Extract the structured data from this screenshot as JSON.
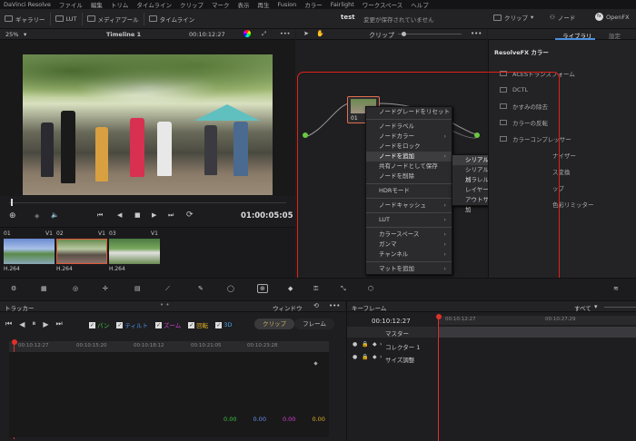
{
  "menubar": [
    "DaVinci Resolve",
    "ファイル",
    "編集",
    "トリム",
    "タイムライン",
    "クリップ",
    "マーク",
    "表示",
    "再生",
    "Fusion",
    "カラー",
    "Fairlight",
    "ワークスペース",
    "ヘルプ"
  ],
  "toolbar": {
    "gallery": "ギャラリー",
    "lut": "LUT",
    "media_pool": "メディアプール",
    "timeline": "タイムライン",
    "project": "test",
    "save_status": "変更が保存されていません",
    "clip": "クリップ",
    "node": "ノード",
    "openfx": "OpenFX"
  },
  "viewer": {
    "zoom": "25%",
    "timeline_name": "Timeline 1",
    "timecode_top": "00:10:12:27",
    "timecode": "01:00:05:05"
  },
  "nodebar": {
    "mode": "クリップ"
  },
  "library": {
    "tab_library": "ライブラリ",
    "tab_settings": "設定",
    "section": "ResolveFX カラー",
    "items": [
      "ACESトランスフォーム",
      "DCTL",
      "かすみの除去",
      "カラーの反転",
      "カラーコンプレッサー"
    ],
    "partial": [
      "ナイザー",
      "ス変換",
      "ップ",
      "色彩リミッター"
    ]
  },
  "clips": [
    {
      "num": "01",
      "track": "V1",
      "codec": "H.264"
    },
    {
      "num": "02",
      "track": "V1",
      "codec": "H.264"
    },
    {
      "num": "03",
      "track": "V1",
      "codec": "H.264"
    }
  ],
  "node": {
    "label": "01"
  },
  "ctx_menu": {
    "items": [
      {
        "label": "ノードグレードをリセット",
        "sub": false
      },
      {
        "sep": true
      },
      {
        "label": "ノードラベル",
        "sub": false
      },
      {
        "label": "ノードカラー",
        "sub": true
      },
      {
        "label": "ノードをロック",
        "sub": false
      },
      {
        "label": "ノードを追加",
        "sub": true,
        "hi": true
      },
      {
        "label": "共有ノードとして保存",
        "sub": false
      },
      {
        "label": "ノードを削除",
        "sub": false
      },
      {
        "sep": true
      },
      {
        "label": "HDRモード",
        "sub": false
      },
      {
        "sep": true
      },
      {
        "label": "ノードキャッシュ",
        "sub": true
      },
      {
        "sep": true
      },
      {
        "label": "LUT",
        "sub": true
      },
      {
        "sep": true
      },
      {
        "label": "カラースペース",
        "sub": true
      },
      {
        "label": "ガンマ",
        "sub": true
      },
      {
        "label": "チャンネル",
        "sub": true
      },
      {
        "sep": true
      },
      {
        "label": "マットを追加",
        "sub": true
      }
    ]
  },
  "submenu": {
    "items": [
      "シリアルノードを追加",
      "シリアルノードを前に追加",
      "パラレルノードを追加",
      "レイヤーノードを追加",
      "アウトサイドノードを追加"
    ]
  },
  "tracker": {
    "title": "トラッカー",
    "window": "ウィンドウ",
    "checks": [
      "パン",
      "ティルト",
      "ズーム",
      "回転",
      "3D"
    ],
    "check_colors": [
      "#3ec43e",
      "#4a90e8",
      "#d040d0",
      "#e0b020",
      "#4aa8e8"
    ],
    "mode_clip": "クリップ",
    "mode_frame": "フレーム",
    "ruler": [
      "00:10:12:27",
      "00:10:15:20",
      "00:10:18:12",
      "00:10:21:05",
      "00:10:23:28"
    ],
    "values": [
      "0.00",
      "0.00",
      "0.00",
      "0.00"
    ],
    "value_colors": [
      "#3ec43e",
      "#6a8ef0",
      "#d040d0",
      "#e0b020"
    ]
  },
  "keyframes": {
    "title": "キーフレーム",
    "all": "すべて",
    "timecode": "00:10:12:27",
    "ruler": [
      "00:10:12:27",
      "00:10:27:29"
    ],
    "rows": [
      "マスター",
      "コレクター 1",
      "サイズ調整"
    ]
  }
}
